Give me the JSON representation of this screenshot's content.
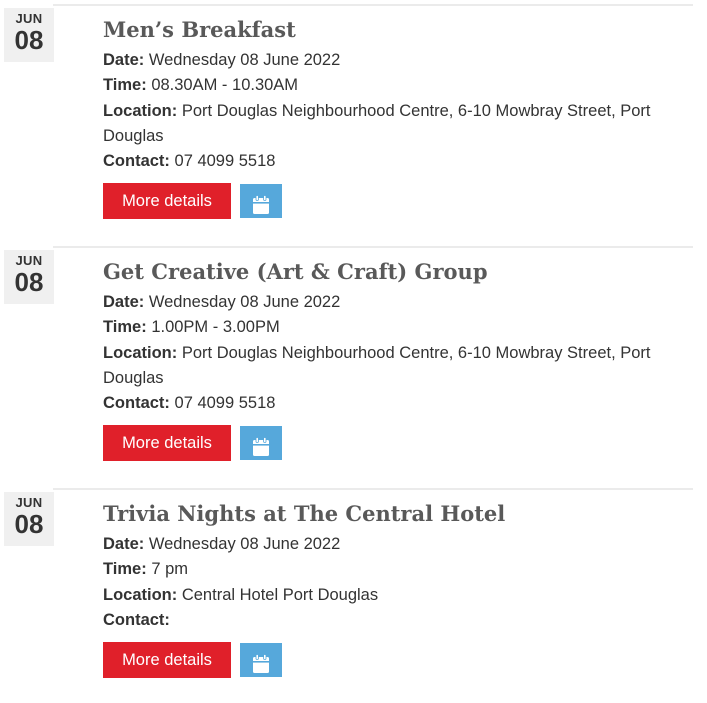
{
  "events": [
    {
      "month": "JUN",
      "day": "08",
      "title": "Men’s Breakfast",
      "date_label": "Date:",
      "date": "Wednesday 08 June 2022",
      "time_label": "Time:",
      "time": "08.30AM - 10.30AM",
      "location_label": "Location:",
      "location": "Port Douglas Neighbourhood Centre, 6-10 Mowbray Street, Port Douglas",
      "contact_label": "Contact:",
      "contact": "07 4099 5518",
      "more_label": "More details",
      "calendar_icon": "calendar-icon"
    },
    {
      "month": "JUN",
      "day": "08",
      "title": "Get Creative (Art & Craft) Group",
      "date_label": "Date:",
      "date": "Wednesday 08 June 2022",
      "time_label": "Time:",
      "time": "1.00PM - 3.00PM",
      "location_label": "Location:",
      "location": "Port Douglas Neighbourhood Centre, 6-10 Mowbray Street, Port Douglas",
      "contact_label": "Contact:",
      "contact": "07 4099 5518",
      "more_label": "More details",
      "calendar_icon": "calendar-icon"
    },
    {
      "month": "JUN",
      "day": "08",
      "title": "Trivia Nights at The Central Hotel",
      "date_label": "Date:",
      "date": "Wednesday 08 June 2022",
      "time_label": "Time:",
      "time": "7 pm",
      "location_label": "Location:",
      "location": "Central Hotel Port Douglas",
      "contact_label": "Contact:",
      "contact": "",
      "more_label": "More details",
      "calendar_icon": "calendar-icon"
    }
  ],
  "colors": {
    "more_button": "#e0202a",
    "calendar_button": "#56a8db",
    "title": "#595959",
    "date_box": "#f0f0f0"
  }
}
